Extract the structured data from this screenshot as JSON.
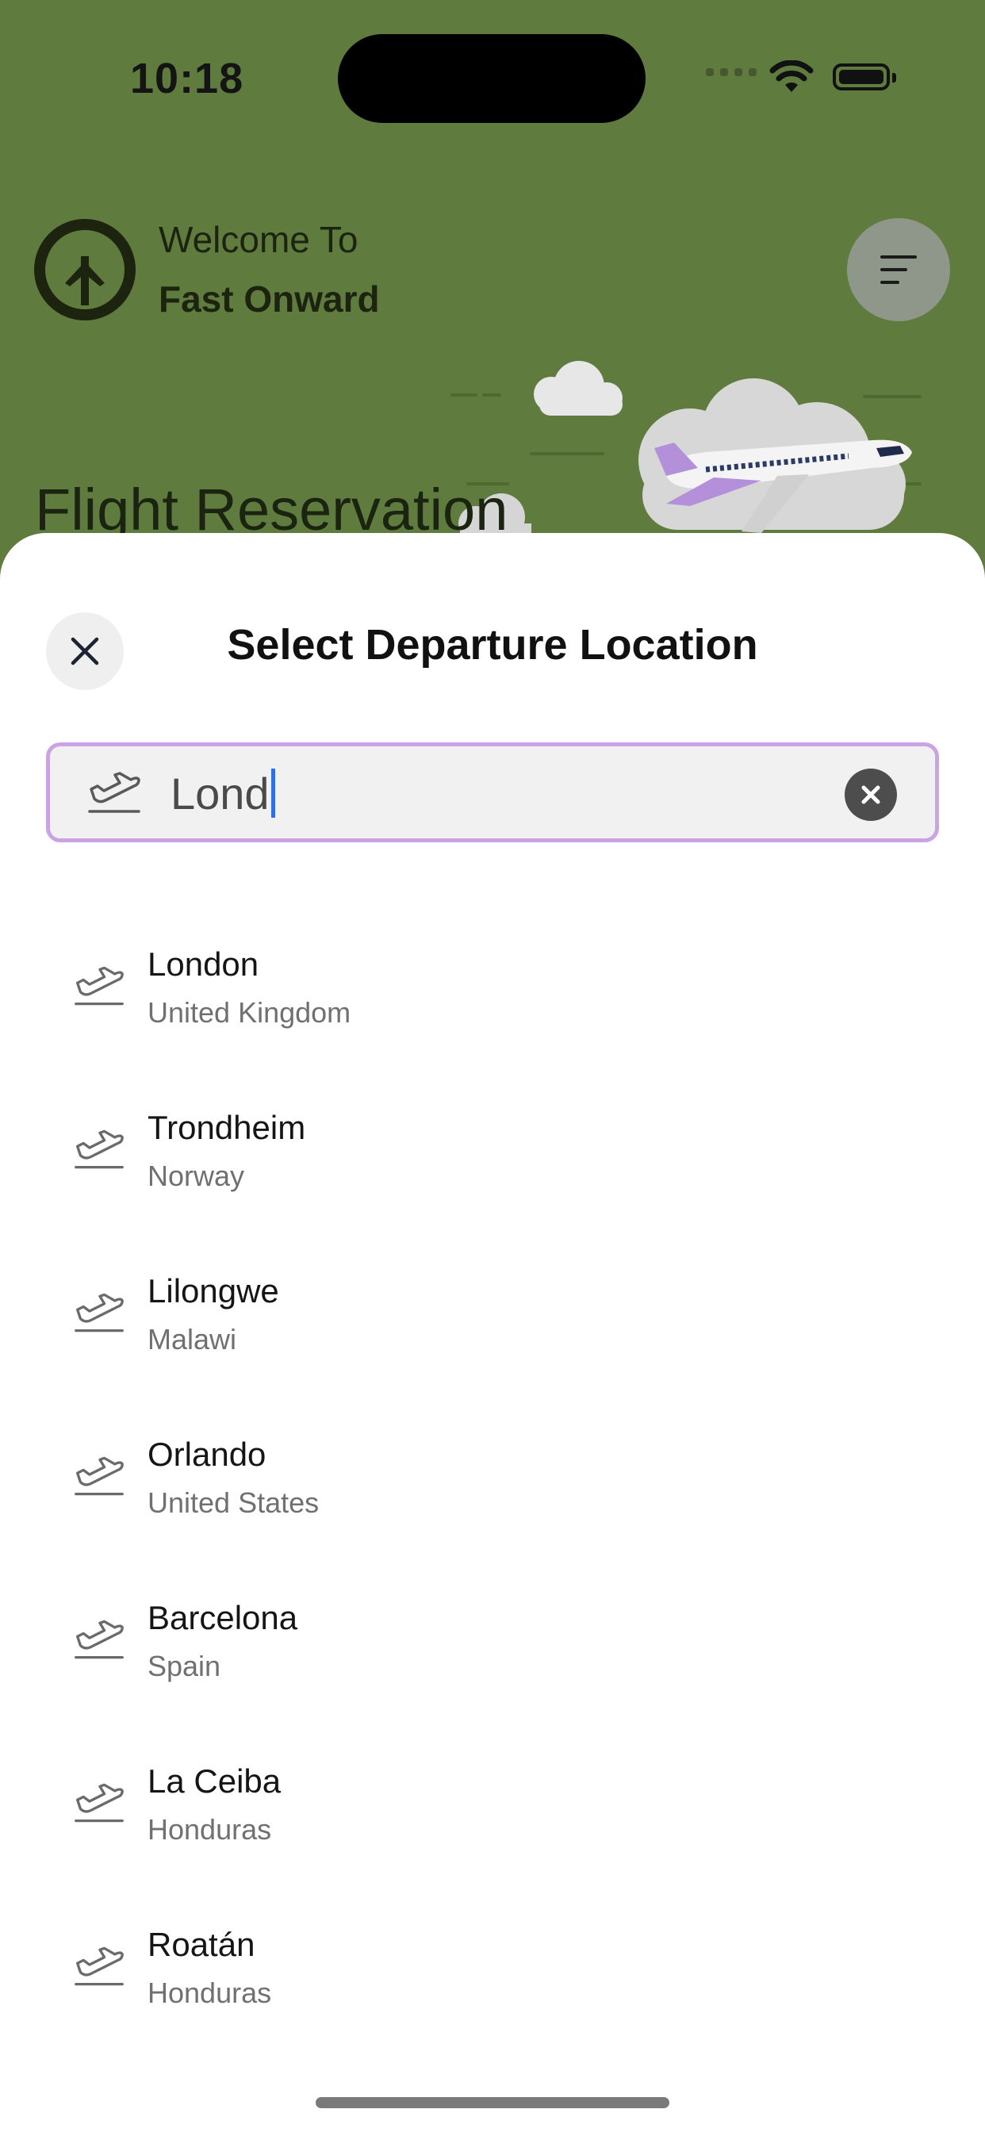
{
  "status": {
    "time": "10:18"
  },
  "header": {
    "welcome": "Welcome To",
    "brand": "Fast Onward",
    "hero_title": "Flight Reservation"
  },
  "sheet": {
    "title": "Select Departure Location",
    "search": {
      "value": "Lond",
      "placeholder": ""
    },
    "results": [
      {
        "city": "London",
        "country": "United Kingdom"
      },
      {
        "city": "Trondheim",
        "country": "Norway"
      },
      {
        "city": "Lilongwe",
        "country": "Malawi"
      },
      {
        "city": "Orlando",
        "country": "United States"
      },
      {
        "city": "Barcelona",
        "country": "Spain"
      },
      {
        "city": "La Ceiba",
        "country": "Honduras"
      },
      {
        "city": "Roatán",
        "country": "Honduras"
      }
    ]
  },
  "colors": {
    "header_bg": "#5f7b3d",
    "search_border": "#c9a3e4",
    "caret": "#2f6fe8"
  },
  "icons": [
    "tree-plane-logo-icon",
    "menu-icon",
    "close-icon",
    "plane-departure-icon",
    "clear-icon"
  ]
}
